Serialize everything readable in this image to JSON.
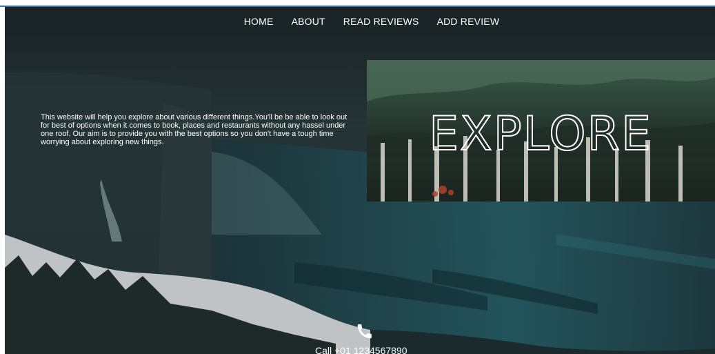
{
  "nav": {
    "items": [
      {
        "label": "HOME"
      },
      {
        "label": "ABOUT"
      },
      {
        "label": "READ REVIEWS"
      },
      {
        "label": "ADD REVIEW"
      }
    ]
  },
  "intro": {
    "text": "This website will help you explore about various different things.You'll be be able to look out for best of options when it comes to book, places and restaurants without any hassel under one roof. Our aim is to provide you with the best options so you don't have a tough time worrying about exploring new things."
  },
  "hero_image": {
    "text": "EXPLORE",
    "icon": "forest-image"
  },
  "footer": {
    "call_text": "Call +01 1234567890",
    "icon": "phone-icon"
  },
  "colors": {
    "nav_text": "#ffffff",
    "accent_line": "#3a72b8",
    "hero_dark": "#1e2f33"
  }
}
